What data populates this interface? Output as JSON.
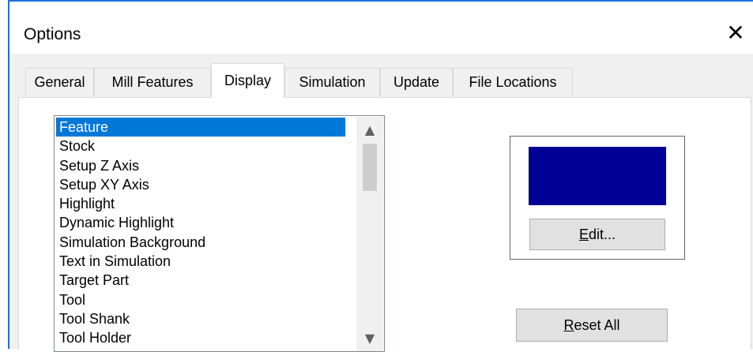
{
  "window": {
    "title": "Options",
    "close_glyph": "✕"
  },
  "tabs": [
    {
      "label": "General",
      "active": false
    },
    {
      "label": "Mill Features",
      "active": false
    },
    {
      "label": "Display",
      "active": true
    },
    {
      "label": "Simulation",
      "active": false
    },
    {
      "label": "Update",
      "active": false
    },
    {
      "label": "File Locations",
      "active": false
    }
  ],
  "display": {
    "items": [
      "Feature",
      "Stock",
      "Setup Z Axis",
      "Setup XY Axis",
      "Highlight",
      "Dynamic Highlight",
      "Simulation Background",
      "Text in Simulation",
      "Target Part",
      "Tool",
      "Tool Shank",
      "Tool Holder"
    ],
    "selected_index": 0,
    "scroll_up_glyph": "▲",
    "scroll_down_glyph": "▼",
    "swatch_color": "#000096",
    "edit_label_mnemonic": "E",
    "edit_label_rest": "dit...",
    "reset_label_mnemonic": "R",
    "reset_label_rest": "eset All"
  },
  "colors": {
    "selection": "#0078d7",
    "window_accent": "#1e6fd9"
  }
}
